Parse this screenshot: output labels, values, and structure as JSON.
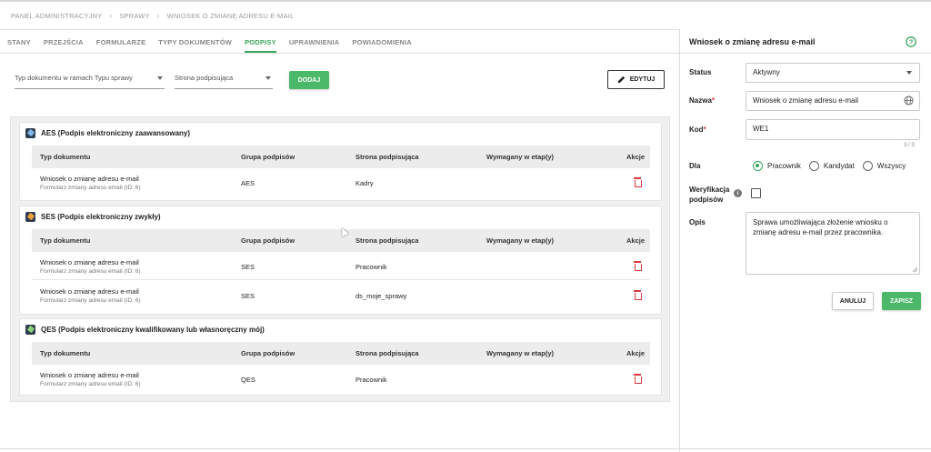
{
  "breadcrumb": [
    "PANEL ADMINISTRACYJNY",
    "SPRAWY",
    "WNIOSEK O ZMIANĘ ADRESU E-MAIL"
  ],
  "tabs": [
    "STANY",
    "PRZEJŚCIA",
    "FORMULARZE",
    "TYPY DOKUMENTÓW",
    "PODPISY",
    "UPRAWNIENIA",
    "POWIADOMIENIA"
  ],
  "active_tab": "PODPISY",
  "filters": {
    "doc_type_placeholder": "Typ dokumentu w ramach Typu sprawy",
    "signing_party_placeholder": "Strona podpisująca",
    "add_label": "DODAJ",
    "edit_label": "EDYTUJ"
  },
  "columns": {
    "doc_type": "Typ dokumentu",
    "group": "Grupa podpisów",
    "party": "Strona podpisująca",
    "stage": "Wymagany w etap(y)",
    "actions": "Akcje"
  },
  "cards": [
    {
      "title": "AES (Podpis elektroniczny zaawansowany)",
      "icon": "signature-aes-icon",
      "rows": [
        {
          "doc": "Wniosek o zmianę adresu e-mail",
          "sub": "Formularz zmiany adresu email (ID: 6)",
          "group": "AES",
          "party": "Kadry",
          "stage": ""
        }
      ]
    },
    {
      "title": "SES (Podpis elektroniczny zwykły)",
      "icon": "signature-ses-icon",
      "rows": [
        {
          "doc": "Wniosek o zmianę adresu e-mail",
          "sub": "Formularz zmiany adresu email (ID: 6)",
          "group": "SES",
          "party": "Pracownik",
          "stage": ""
        },
        {
          "doc": "Wniosek o zmianę adresu e-mail",
          "sub": "Formularz zmiany adresu email (ID: 6)",
          "group": "SES",
          "party": "ds_moje_sprawy",
          "stage": ""
        }
      ]
    },
    {
      "title": "QES (Podpis elektroniczny kwalifikowany lub własnoręczny mój)",
      "icon": "signature-qes-icon",
      "rows": [
        {
          "doc": "Wniosek o zmianę adresu e-mail",
          "sub": "Formularz zmiany adresu email (ID: 6)",
          "group": "QES",
          "party": "Pracownik",
          "stage": ""
        }
      ]
    }
  ],
  "panel": {
    "title": "Wniosek o zmianę adresu e-mail",
    "status_label": "Status",
    "status_value": "Aktywny",
    "name_label": "Nazwa",
    "name_value": "Wniosek o zmianę adresu e-mail",
    "code_label": "Kod",
    "code_value": "WE1",
    "code_counter": "3 / 3",
    "for_label": "Dla",
    "for_options": [
      "Pracownik",
      "Kandydat",
      "Wszyscy"
    ],
    "for_selected": "Pracownik",
    "verification_label_1": "Weryfikacja",
    "verification_label_2": "podpisów",
    "description_label": "Opis",
    "description_value": "Sprawa umożliwiająca złożenie wniosku o zmianę adresu e-mail przez pracownika.",
    "cancel_label": "ANULUJ",
    "save_label": "ZAPISZ"
  },
  "colors": {
    "accent": "#3aa55a",
    "danger": "#d9363e"
  }
}
